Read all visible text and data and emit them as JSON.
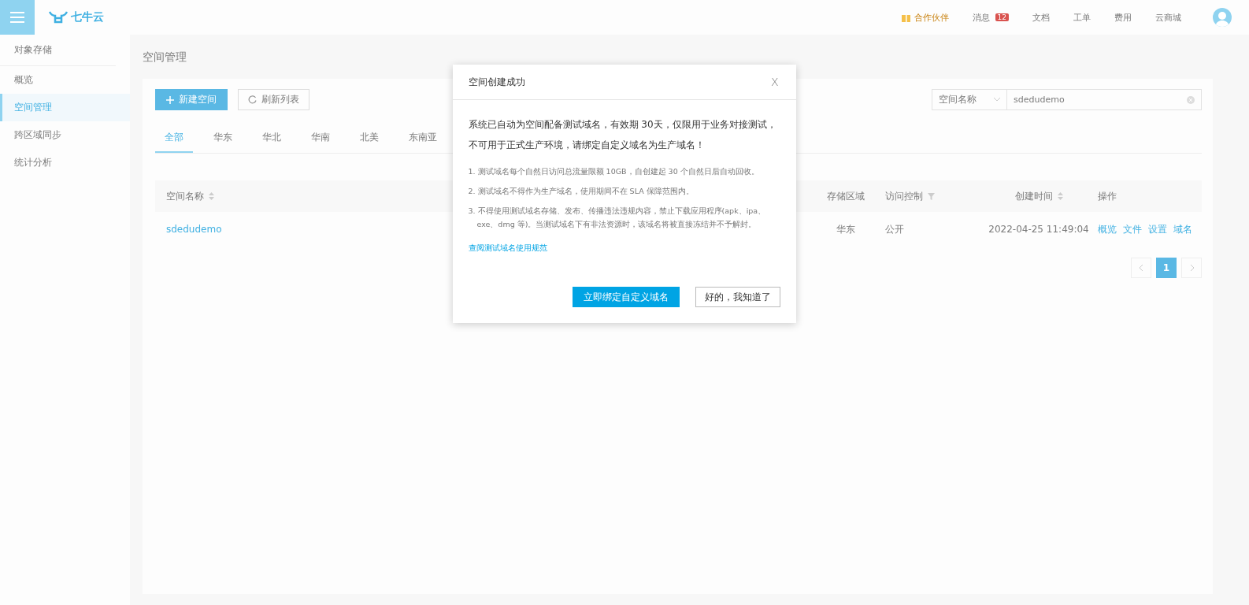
{
  "topbar": {
    "logo": "七牛云",
    "links": [
      {
        "label": "合作伙伴",
        "kind": "gift"
      },
      {
        "label": "消息",
        "kind": "badge",
        "badge": "12"
      },
      {
        "label": "文档",
        "kind": "plain"
      },
      {
        "label": "工单",
        "kind": "plain"
      },
      {
        "label": "费用",
        "kind": "plain"
      },
      {
        "label": "云商城",
        "kind": "plain"
      }
    ]
  },
  "sidebar": {
    "heading": "对象存储",
    "items": [
      {
        "label": "概览",
        "selected": false
      },
      {
        "label": "空间管理",
        "selected": true
      },
      {
        "label": "跨区域同步",
        "selected": false
      },
      {
        "label": "统计分析",
        "selected": false
      }
    ]
  },
  "page_title": "空间管理",
  "toolbar": {
    "create_button": "新建空间",
    "refresh_button": "刷新列表",
    "search_type": "空间名称",
    "search_value": "sdedudemo"
  },
  "tabs": [
    {
      "label": "全部",
      "selected": true
    },
    {
      "label": "华东",
      "selected": false
    },
    {
      "label": "华北",
      "selected": false
    },
    {
      "label": "华南",
      "selected": false
    },
    {
      "label": "北美",
      "selected": false
    },
    {
      "label": "东南亚",
      "selected": false
    }
  ],
  "table": {
    "columns": [
      {
        "label": "空间名称",
        "kind": "sort"
      },
      {
        "label": "存储区域",
        "kind": "plain"
      },
      {
        "label": "访问控制",
        "kind": "filter"
      },
      {
        "label": "创建时间",
        "kind": "sort"
      },
      {
        "label": "操作",
        "kind": "plain"
      }
    ],
    "rows": [
      {
        "name": "sdedudemo",
        "region": "华东",
        "access": "公开",
        "created": "2022-04-25 11:49:04",
        "actions": [
          "概览",
          "文件",
          "设置",
          "域名"
        ]
      }
    ]
  },
  "pagination": {
    "pages": [
      {
        "label": "1",
        "selected": true
      }
    ]
  },
  "dialog": {
    "title": "空间创建成功",
    "close": "X",
    "message": "系统已自动为空间配备测试域名，有效期 30天，仅限用于业务对接测试，不可用于正式生产环境，请绑定自定义域名为生产域名！",
    "notes": [
      "1. 测试域名每个自然日访问总流量限额 10GB，自创建起 30 个自然日后自动回收。",
      "2. 测试域名不得作为生产域名，使用期间不在 SLA 保障范围内。",
      "3. 不得使用测试域名存储、发布、传播违法违规内容，禁止下载应用程序(apk、ipa、exe、dmg 等)。当测试域名下有非法资源时，该域名将被直接冻结并不予解封。"
    ],
    "link": "查阅测试域名使用规范",
    "primary_button": "立即绑定自定义域名",
    "secondary_button": "好的，我知道了"
  }
}
